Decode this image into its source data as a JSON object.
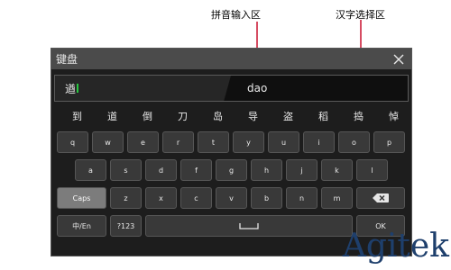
{
  "annotations": {
    "pinyin_area": "拼音输入区",
    "hanzi_area": "汉字选择区"
  },
  "window": {
    "title": "键盘",
    "close_icon": "close-icon"
  },
  "input": {
    "candidate_preview": "遒",
    "pinyin_value": "dao"
  },
  "candidates": [
    "到",
    "道",
    "倒",
    "刀",
    "岛",
    "导",
    "盗",
    "稻",
    "捣",
    "悼"
  ],
  "keys": {
    "row1": [
      "q",
      "w",
      "e",
      "r",
      "t",
      "y",
      "u",
      "i",
      "o",
      "p"
    ],
    "row2": [
      "a",
      "s",
      "d",
      "f",
      "g",
      "h",
      "j",
      "k",
      "l"
    ],
    "caps": "Caps",
    "row3": [
      "z",
      "x",
      "c",
      "v",
      "b",
      "n",
      "m"
    ],
    "backspace_icon": "backspace-icon",
    "lang": "中/En",
    "symbols": "?123",
    "space_icon": "space-bar-icon",
    "ok": "OK"
  },
  "watermark": "Agitek",
  "colors": {
    "window_bg": "#1d1d1d",
    "titlebar_bg": "#4b4b4b",
    "key_bg": "#393939",
    "caps_bg": "#7c7c7c",
    "arrow_red": "#c8102e",
    "cursor_green": "#28c840",
    "watermark": "#1e3f6c"
  }
}
